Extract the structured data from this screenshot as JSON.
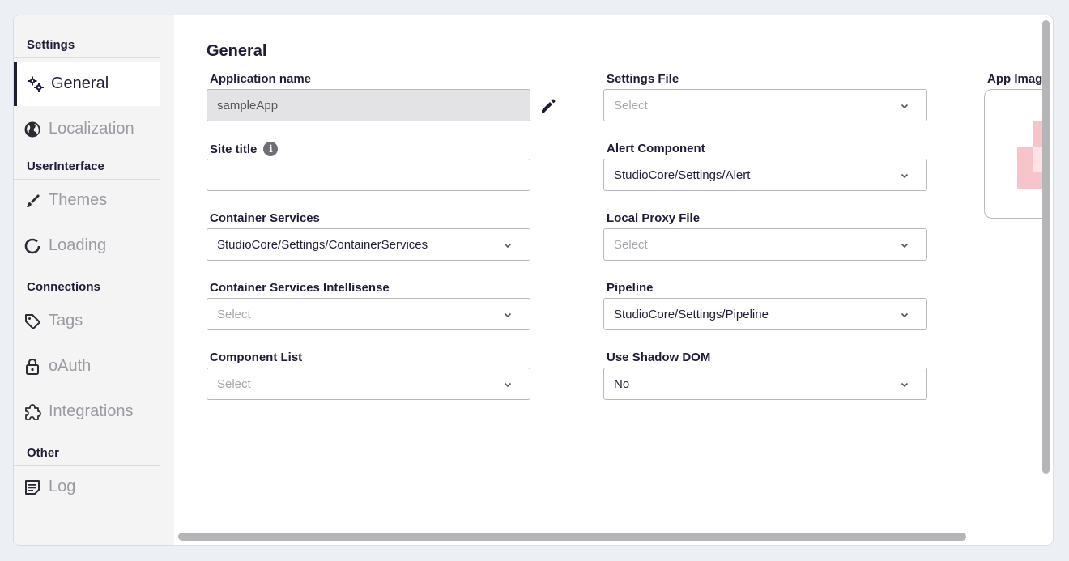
{
  "sidebar": {
    "sections": [
      {
        "title": "Settings"
      },
      {
        "title": "UserInterface"
      },
      {
        "title": "Connections"
      },
      {
        "title": "Other"
      }
    ],
    "items": [
      {
        "label": "General",
        "icon": "gears-icon",
        "active": true
      },
      {
        "label": "Localization",
        "icon": "globe-icon"
      },
      {
        "label": "Themes",
        "icon": "brush-icon"
      },
      {
        "label": "Loading",
        "icon": "loading-circle-icon"
      },
      {
        "label": "Tags",
        "icon": "tag-icon"
      },
      {
        "label": "oAuth",
        "icon": "lock-icon"
      },
      {
        "label": "Integrations",
        "icon": "puzzle-icon"
      },
      {
        "label": "Log",
        "icon": "log-icon"
      }
    ]
  },
  "main": {
    "title": "General",
    "fields": {
      "application_name": {
        "label": "Application name",
        "value": "sampleApp"
      },
      "site_title": {
        "label": "Site title",
        "value": ""
      },
      "container_services": {
        "label": "Container Services",
        "value": "StudioCore/Settings/ContainerServices"
      },
      "container_services_intellisense": {
        "label": "Container Services Intellisense",
        "placeholder": "Select"
      },
      "component_list": {
        "label": "Component List",
        "placeholder": "Select"
      },
      "settings_file": {
        "label": "Settings File",
        "placeholder": "Select"
      },
      "alert_component": {
        "label": "Alert Component",
        "value": "StudioCore/Settings/Alert"
      },
      "local_proxy_file": {
        "label": "Local Proxy File",
        "placeholder": "Select"
      },
      "pipeline": {
        "label": "Pipeline",
        "value": "StudioCore/Settings/Pipeline"
      },
      "use_shadow_dom": {
        "label": "Use Shadow DOM",
        "value": "No"
      },
      "app_image": {
        "label": "App Imag"
      }
    }
  },
  "colors": {
    "accent": "#1f1d35",
    "muted": "#9a9aa2",
    "sidebar_bg": "#f4f4f5",
    "image_tint": "#f7c5c9"
  }
}
